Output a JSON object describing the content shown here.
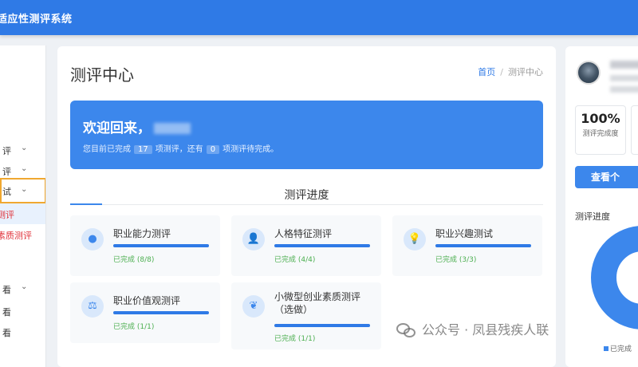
{
  "app": {
    "title": "适应性测评系统"
  },
  "sidebar": {
    "items": [
      {
        "label": "评",
        "chevron": true
      },
      {
        "label": "评",
        "chevron": true
      },
      {
        "label": "试",
        "chevron": true,
        "active": true
      },
      {
        "label": "测评",
        "chevron": false,
        "red": true,
        "sub": true
      },
      {
        "label": "素质测评",
        "chevron": false,
        "red": true
      },
      {
        "label": "看",
        "chevron": true
      },
      {
        "label": "看",
        "chevron": false
      },
      {
        "label": "看",
        "chevron": false
      }
    ]
  },
  "header": {
    "page_title": "测评中心",
    "breadcrumb": {
      "home": "首页",
      "separator": "/",
      "current": "测评中心"
    }
  },
  "welcome": {
    "greeting": "欢迎回来，",
    "stat_prefix": "您目前已完成",
    "completed": "17",
    "stat_middle": "项测评，还有",
    "pending": "0",
    "stat_suffix": "项测评待完成。"
  },
  "tabs": {
    "progress_title": "测评进度"
  },
  "assessments": [
    {
      "name": "职业能力测评",
      "status": "已完成 (8/8)",
      "icon": "brain-icon",
      "progress": 1.0
    },
    {
      "name": "人格特征测评",
      "status": "已完成 (4/4)",
      "icon": "user-icon",
      "progress": 1.0
    },
    {
      "name": "职业兴趣测试",
      "status": "已完成 (3/3)",
      "icon": "lightbulb-icon",
      "progress": 1.0
    },
    {
      "name": "职业价值观测评",
      "status": "已完成 (1/1)",
      "icon": "scale-icon",
      "progress": 1.0
    },
    {
      "name": "小微型创业素质测评（选做）",
      "status": "已完成 (1/1)",
      "icon": "sprout-icon",
      "progress": 1.0
    }
  ],
  "profile": {
    "completion_rate": "100%",
    "completion_label": "测评完成度",
    "view_button": "查看个",
    "progress_title": "测评进度",
    "legend_label": "已完成"
  },
  "watermark": {
    "text": "公众号 · 凤县残疾人联"
  },
  "colors": {
    "primary": "#2f7ae6",
    "accent": "#3c87ec",
    "success": "#4caf50",
    "highlight_border": "#f0a830",
    "alert_text": "#e0323a"
  }
}
